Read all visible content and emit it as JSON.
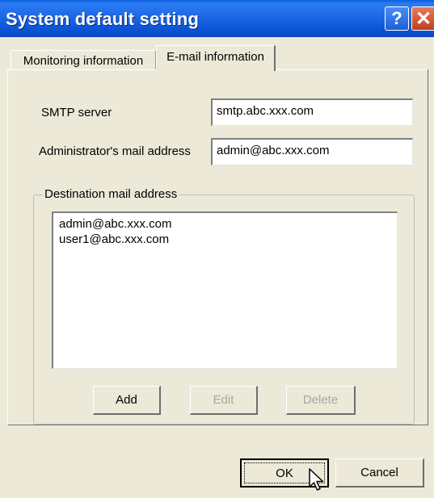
{
  "window": {
    "title": "System default setting",
    "help_glyph": "?",
    "close_glyph": "✕"
  },
  "tabs": [
    {
      "label": "Monitoring information",
      "selected": false
    },
    {
      "label": "E-mail information",
      "selected": true
    }
  ],
  "form": {
    "smtp_label": "SMTP server",
    "smtp_value": "smtp.abc.xxx.com",
    "admin_label": "Administrator's mail address",
    "admin_value": "admin@abc.xxx.com"
  },
  "destination": {
    "group_label": "Destination mail address",
    "items": [
      "admin@abc.xxx.com",
      "user1@abc.xxx.com"
    ],
    "buttons": {
      "add": "Add",
      "edit": "Edit",
      "delete": "Delete"
    }
  },
  "footer": {
    "ok": "OK",
    "cancel": "Cancel"
  },
  "icons": {
    "help": "help-icon",
    "close": "close-icon",
    "cursor": "arrow-cursor-icon"
  },
  "colors": {
    "titlebar": "#0A5FE0",
    "face": "#ECE9D8",
    "close": "#C2401E",
    "disabled_text": "#A8A79B"
  }
}
